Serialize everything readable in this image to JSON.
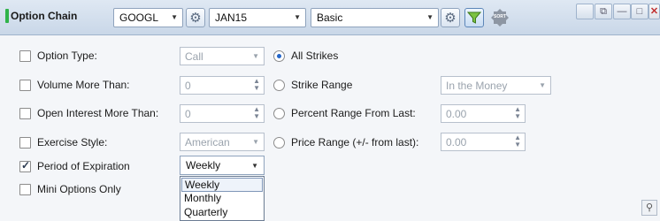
{
  "header": {
    "title": "Option Chain",
    "symbol": "GOOGL",
    "expiry": "JAN15",
    "layout": "Basic",
    "sort_label": "SORT",
    "accent_color": "#2fb34a"
  },
  "window": {
    "restore": "⧉",
    "minimize": "—",
    "maximize": "□",
    "close": "✕"
  },
  "filters": {
    "option_type": {
      "label": "Option Type:",
      "checked": false,
      "value": "Call"
    },
    "volume": {
      "label": "Volume More Than:",
      "checked": false,
      "value": "0"
    },
    "open_interest": {
      "label": "Open Interest More Than:",
      "checked": false,
      "value": "0"
    },
    "exercise_style": {
      "label": "Exercise Style:",
      "checked": false,
      "value": "American"
    },
    "period_expiration": {
      "label": "Period of Expiration",
      "checked": true,
      "value": "Weekly",
      "options": [
        "Weekly",
        "Monthly",
        "Quarterly"
      ]
    },
    "mini_options": {
      "label": "Mini Options Only",
      "checked": false
    }
  },
  "strikes": {
    "all_strikes": {
      "label": "All Strikes",
      "selected": true
    },
    "strike_range": {
      "label": "Strike Range",
      "selected": false,
      "value": "In the Money"
    },
    "percent_range": {
      "label": "Percent Range From Last:",
      "selected": false,
      "value": "0.00"
    },
    "price_range": {
      "label": "Price Range (+/- from last):",
      "selected": false,
      "value": "0.00"
    }
  },
  "icons": {
    "settings": "gear-icon",
    "filter": "filter-icon",
    "sort": "sort-icon",
    "pin": "pin-icon"
  }
}
